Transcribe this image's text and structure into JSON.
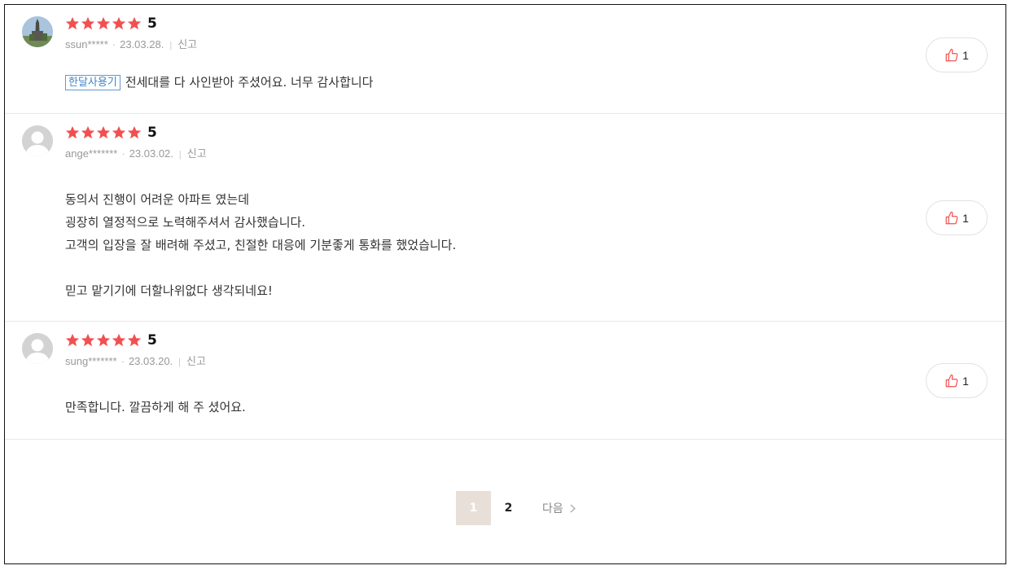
{
  "reviews": [
    {
      "user": "ssun*****",
      "date": "23.03.28.",
      "score": "5",
      "report_label": "신고",
      "tag": "한달사용기",
      "lines": [
        "전세대를 다 사인받아 주셨어요. 너무 감사합니다"
      ],
      "likes": "1",
      "avatar": "photo"
    },
    {
      "user": "ange*******",
      "date": "23.03.02.",
      "score": "5",
      "report_label": "신고",
      "tag": "",
      "lines": [
        "동의서 진행이 어려운 아파트 였는데",
        "굉장히 열정적으로 노력해주셔서 감사했습니다.",
        "고객의 입장을 잘 배려해 주셨고, 친절한 대응에 기분좋게 통화를 했었습니다.",
        "",
        "믿고 맡기기에 더할나위없다 생각되네요!"
      ],
      "likes": "1",
      "avatar": "default"
    },
    {
      "user": "sung*******",
      "date": "23.03.20.",
      "score": "5",
      "report_label": "신고",
      "tag": "",
      "lines": [
        "만족합니다. 깔끔하게 해 주 셨어요."
      ],
      "likes": "1",
      "avatar": "default"
    }
  ],
  "pagination": {
    "pages": [
      "1",
      "2"
    ],
    "current": "1",
    "next_label": "다음"
  },
  "colors": {
    "star": "#f25050",
    "tag_border": "#5e9bd4",
    "active_page_bg": "#e8e0d8",
    "like_icon": "#f25050"
  },
  "icons": {
    "star": "star-icon",
    "like": "thumbs-up-icon",
    "next": "chevron-right-icon"
  }
}
